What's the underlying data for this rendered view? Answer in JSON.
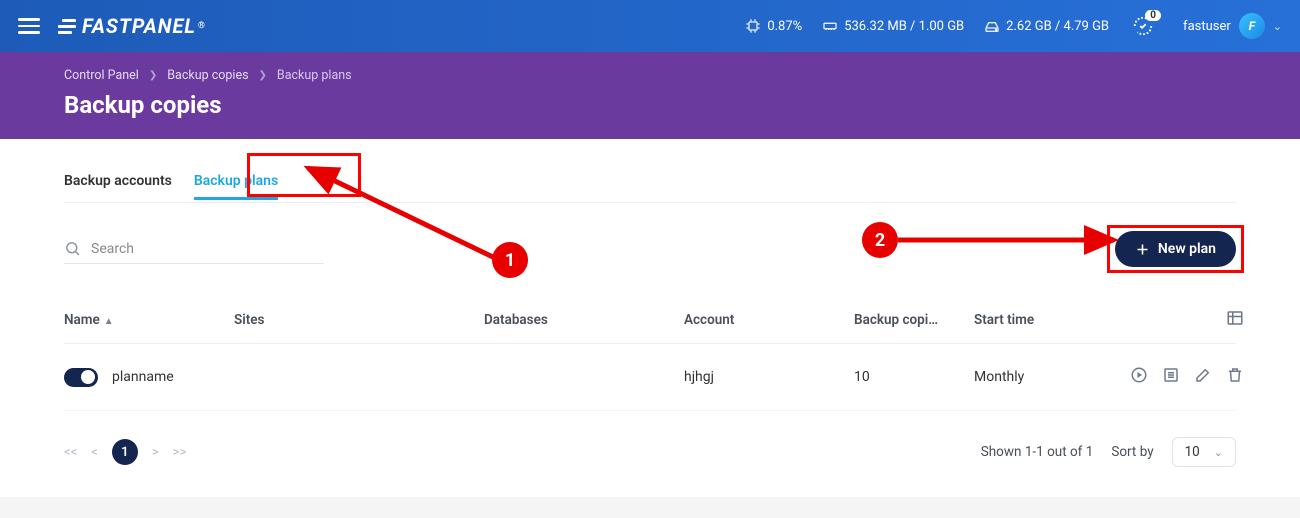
{
  "topbar": {
    "cpu_pct": "0.87%",
    "ram": "536.32 MB / 1.00 GB",
    "disk": "2.62 GB / 4.79 GB",
    "notif_count": "0",
    "username": "fastuser",
    "avatar_letter": "F",
    "brand": "FASTPANEL"
  },
  "breadcrumb": {
    "a": "Control Panel",
    "b": "Backup copies",
    "c": "Backup plans"
  },
  "page_title": "Backup copies",
  "tabs": {
    "accounts": "Backup accounts",
    "plans": "Backup plans"
  },
  "search_placeholder": "Search",
  "new_plan_label": "New plan",
  "columns": {
    "name": "Name",
    "sites": "Sites",
    "databases": "Databases",
    "account": "Account",
    "copies": "Backup copi…",
    "start": "Start time"
  },
  "rows": [
    {
      "name": "planname",
      "sites": "",
      "databases": "",
      "account": "hjhgj",
      "copies": "10",
      "start": "Monthly",
      "enabled": true
    }
  ],
  "pagination": {
    "current": "1"
  },
  "footer": {
    "shown": "Shown 1-1 out of 1",
    "sort_label": "Sort by",
    "per_page": "10"
  },
  "annotations": {
    "one": "1",
    "two": "2"
  }
}
